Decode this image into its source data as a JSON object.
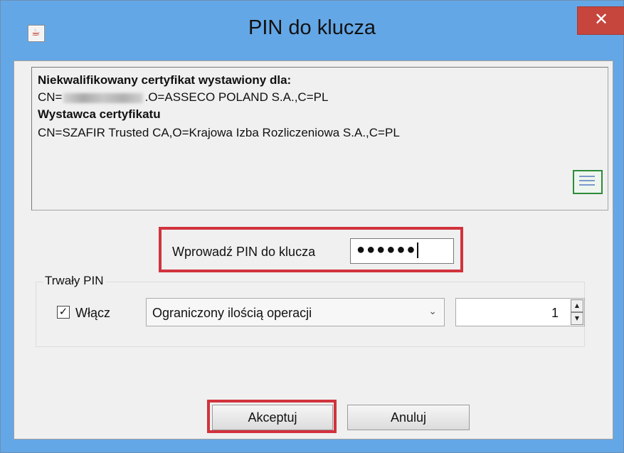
{
  "window": {
    "title": "PIN do klucza",
    "close_symbol": "✕",
    "app_icon": "java-icon"
  },
  "certificate": {
    "holder_heading": "Niekwalifikowany certyfikat wystawiony dla:",
    "holder_cn_prefix": "CN=",
    "holder_rest": ".O=ASSECO POLAND S.A.,C=PL",
    "issuer_heading": "Wystawca certyfikatu",
    "issuer_value": "CN=SZAFIR Trusted CA,O=Krajowa Izba Rozliczeniowa S.A.,C=PL",
    "icon": "certificate-icon"
  },
  "pin": {
    "label": "Wprowadź PIN do klucza",
    "masked_value": "●●●●●●"
  },
  "persistent_pin": {
    "group_label": "Trwały PIN",
    "enable_label": "Włącz",
    "enabled": true,
    "check_symbol": "✓",
    "mode_selected": "Ograniczony ilością operacji",
    "count_value": "1"
  },
  "buttons": {
    "accept": "Akceptuj",
    "cancel": "Anuluj"
  },
  "colors": {
    "titlebar": "#64a7e6",
    "close_button": "#c6453d",
    "highlight": "#d1333d"
  }
}
